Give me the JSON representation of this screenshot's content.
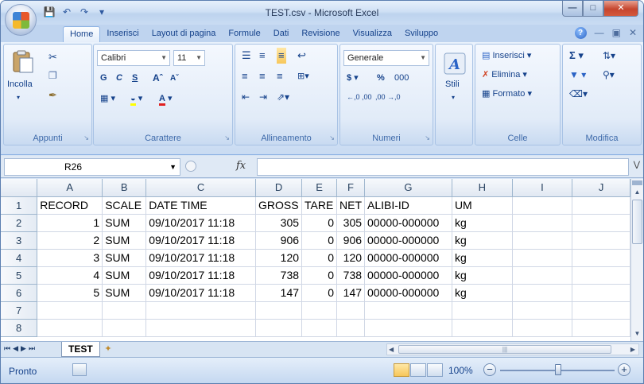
{
  "window": {
    "title": "TEST.csv - Microsoft Excel"
  },
  "ribbon_tabs": [
    "Home",
    "Inserisci",
    "Layout di pagina",
    "Formule",
    "Dati",
    "Revisione",
    "Visualizza",
    "Sviluppo"
  ],
  "groups": {
    "appunti": {
      "label": "Appunti",
      "paste": "Incolla"
    },
    "carattere": {
      "label": "Carattere",
      "font": "Calibri",
      "size": "11",
      "bold": "G",
      "italic": "C",
      "underline": "S"
    },
    "allineamento": {
      "label": "Allineamento"
    },
    "numeri": {
      "label": "Numeri",
      "format": "Generale",
      "currency": "$",
      "percent": "%",
      "thousands": "000"
    },
    "stili": {
      "label": "Stili"
    },
    "celle": {
      "label": "Celle",
      "insert": "Inserisci",
      "delete": "Elimina",
      "format": "Formato"
    },
    "modifica": {
      "label": "Modifica"
    }
  },
  "formula_bar": {
    "name_box": "R26",
    "fx": "fx",
    "formula": ""
  },
  "sheet": {
    "columns": [
      "A",
      "B",
      "C",
      "D",
      "E",
      "F",
      "G",
      "H",
      "I",
      "J"
    ],
    "rows": [
      {
        "n": "1",
        "cells": [
          "RECORD",
          "SCALE",
          "DATE TIME",
          "GROSS",
          "TARE",
          "NET",
          "ALIBI-ID",
          "UM",
          "",
          ""
        ]
      },
      {
        "n": "2",
        "cells": [
          "1",
          "SUM",
          "09/10/2017 11:18",
          "305",
          "0",
          "305",
          "00000-000000",
          "kg",
          "",
          ""
        ]
      },
      {
        "n": "3",
        "cells": [
          "2",
          "SUM",
          "09/10/2017 11:18",
          "906",
          "0",
          "906",
          "00000-000000",
          "kg",
          "",
          ""
        ]
      },
      {
        "n": "4",
        "cells": [
          "3",
          "SUM",
          "09/10/2017 11:18",
          "120",
          "0",
          "120",
          "00000-000000",
          "kg",
          "",
          ""
        ]
      },
      {
        "n": "5",
        "cells": [
          "4",
          "SUM",
          "09/10/2017 11:18",
          "738",
          "0",
          "738",
          "00000-000000",
          "kg",
          "",
          ""
        ]
      },
      {
        "n": "6",
        "cells": [
          "5",
          "SUM",
          "09/10/2017 11:18",
          "147",
          "0",
          "147",
          "00000-000000",
          "kg",
          "",
          ""
        ]
      },
      {
        "n": "7",
        "cells": [
          "",
          "",
          "",
          "",
          "",
          "",
          "",
          "",
          "",
          ""
        ]
      },
      {
        "n": "8",
        "cells": [
          "",
          "",
          "",
          "",
          "",
          "",
          "",
          "",
          "",
          ""
        ]
      }
    ]
  },
  "sheet_tabs": [
    "TEST"
  ],
  "status": {
    "text": "Pronto",
    "zoom": "100%"
  }
}
